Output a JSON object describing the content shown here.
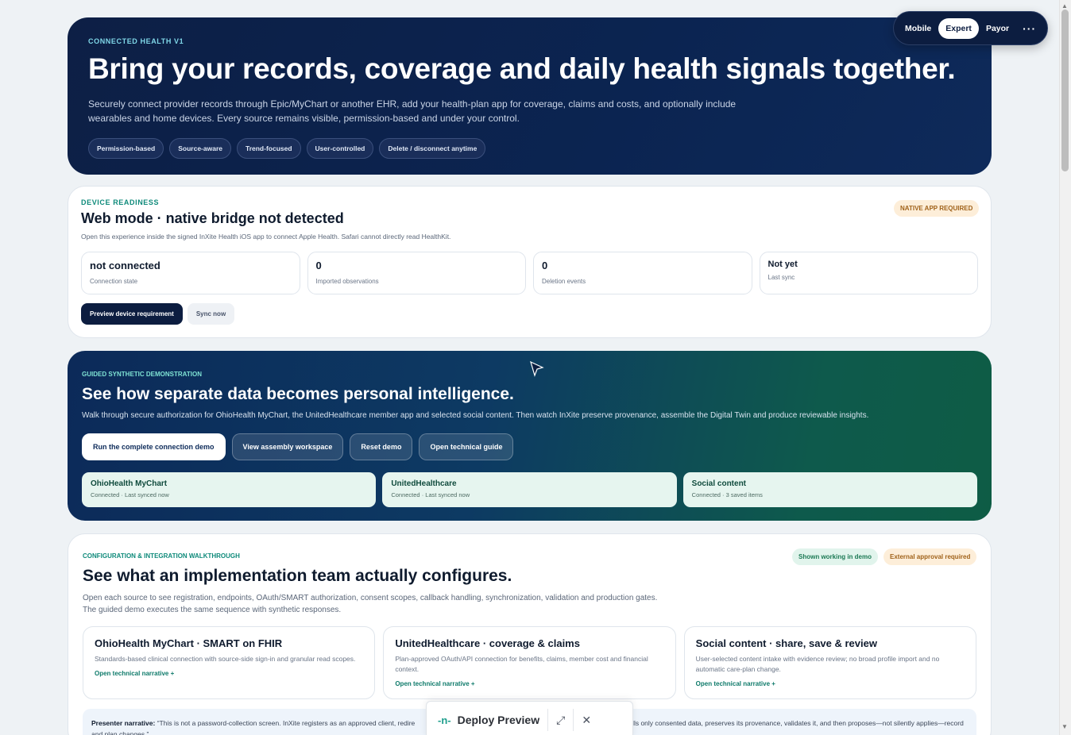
{
  "hero": {
    "eyebrow": "CONNECTED HEALTH V1",
    "title": "Bring your records, coverage and daily health signals together.",
    "description": "Securely connect provider records through Epic/MyChart or another EHR, add your health-plan app for coverage, claims and costs, and optionally include wearables and home devices. Every source remains visible, permission-based and under your control.",
    "pills": [
      "Permission-based",
      "Source-aware",
      "Trend-focused",
      "User-controlled",
      "Delete / disconnect anytime"
    ]
  },
  "mode_switch": {
    "options": [
      "Mobile",
      "Expert",
      "Payor"
    ],
    "selected": "Expert",
    "more": "···"
  },
  "device": {
    "eyebrow": "DEVICE READINESS",
    "title": "Web mode · native bridge not detected",
    "subtitle": "Open this experience inside the signed InXite Health iOS app to connect Apple Health. Safari cannot directly read HealthKit.",
    "badge": "NATIVE APP REQUIRED",
    "stats": [
      {
        "value": "not connected",
        "label": "Connection state"
      },
      {
        "value": "0",
        "label": "Imported observations"
      },
      {
        "value": "0",
        "label": "Deletion events"
      },
      {
        "value": "Not yet",
        "label": "Last sync"
      }
    ],
    "primary_button": "Preview device requirement",
    "secondary_button": "Sync now"
  },
  "demo": {
    "eyebrow": "GUIDED SYNTHETIC DEMONSTRATION",
    "title": "See how separate data becomes personal intelligence.",
    "description": "Walk through secure authorization for OhioHealth MyChart, the UnitedHealthcare member app and selected social content. Then watch InXite preserve provenance, assemble the Digital Twin and produce reviewable insights.",
    "buttons": [
      "Run the complete connection demo",
      "View assembly workspace",
      "Reset demo",
      "Open technical guide"
    ],
    "sources": [
      {
        "name": "OhioHealth MyChart",
        "status": "Connected · Last synced now"
      },
      {
        "name": "UnitedHealthcare",
        "status": "Connected · Last synced now"
      },
      {
        "name": "Social content",
        "status": "Connected · 3 saved items"
      }
    ]
  },
  "config": {
    "eyebrow": "CONFIGURATION & INTEGRATION WALKTHROUGH",
    "title": "See what an implementation team actually configures.",
    "description": "Open each source to see registration, endpoints, OAuth/SMART authorization, consent scopes, callback handling, synchronization, validation and production gates. The guided demo executes the same sequence with synthetic responses.",
    "badge_ok": "Shown working in demo",
    "badge_warn": "External approval required",
    "tiles": [
      {
        "title": "OhioHealth MyChart · SMART on FHIR",
        "desc": "Standards-based clinical connection with source-side sign-in and granular read scopes.",
        "link": "Open technical narrative +"
      },
      {
        "title": "UnitedHealthcare · coverage & claims",
        "desc": "Plan-approved OAuth/API connection for benefits, claims, member cost and financial context.",
        "link": "Open technical narrative +"
      },
      {
        "title": "Social content · share, save & review",
        "desc": "User-selected content intake with evidence review; no broad profile import and no automatic care-plan change.",
        "link": "Open technical narrative +"
      }
    ],
    "narrative_label": "Presenter narrative:",
    "narrative_text": "“This is not a password-collection screen. InXite registers as an approved client, redire",
    "narrative_tail": "sult, pulls only consented data, preserves its provenance, validates it, and then proposes—not silently applies—record and plan changes.”"
  },
  "deploy_bar": {
    "label": "Deploy Preview",
    "logo": "-n-",
    "expand": "⤢",
    "close": "✕"
  },
  "colors": {
    "navy": "#0c1d40",
    "teal": "#0e8a7a",
    "warn_bg": "#fdeed9",
    "ok_bg": "#e1f4ec"
  },
  "icons": {
    "scroll_up": "▲",
    "scroll_down": "▼"
  }
}
